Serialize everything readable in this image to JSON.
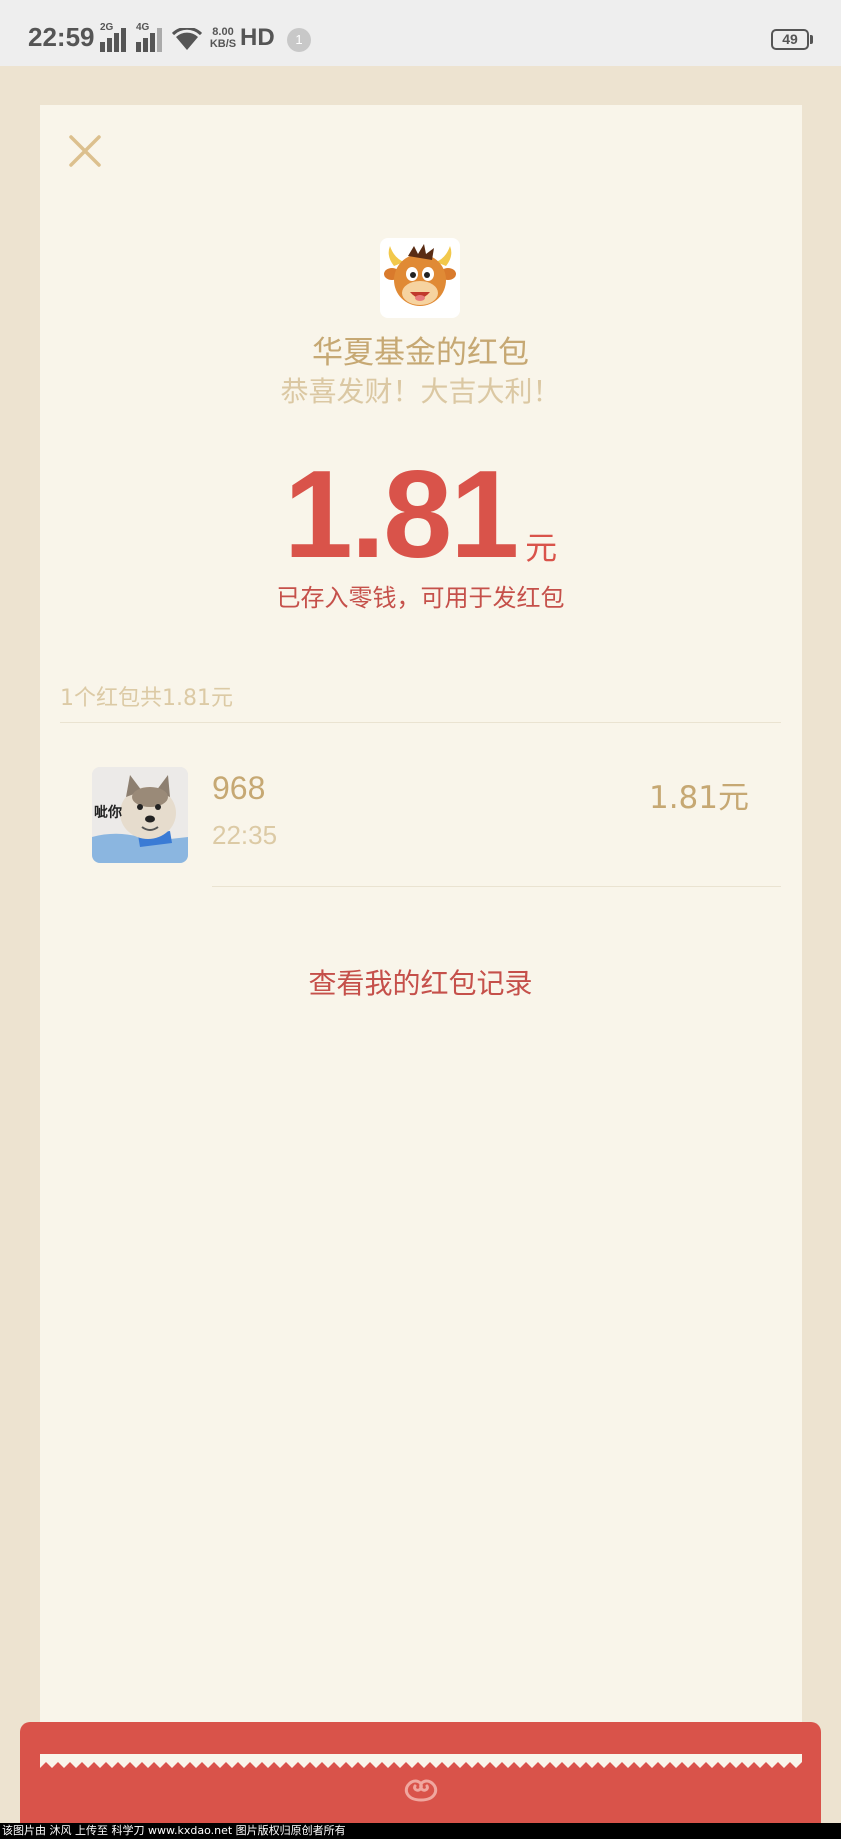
{
  "status_bar": {
    "time": "22:59",
    "signal_1_label": "2G",
    "signal_2_label": "4G",
    "net_speed_value": "8.00",
    "net_speed_unit": "KB/S",
    "hd_label": "HD",
    "notification_count": "1",
    "battery": "49"
  },
  "packet": {
    "sender_name": "华夏基金的红包",
    "blessing": "恭喜发财！大吉大利！",
    "amount": "1.81",
    "amount_unit": "元",
    "saved_note": "已存入零钱，可用于发红包",
    "summary": "1个红包共1.81元"
  },
  "receivers": [
    {
      "name": "968",
      "time": "22:35",
      "amount": "1.81元",
      "avatar_caption": "呲你"
    }
  ],
  "records_link": "查看我的红包记录",
  "watermark": "该图片由 沐风 上传至 科学刀 www.kxdao.net 图片版权归原创者所有",
  "colors": {
    "background": "#ede3d0",
    "card": "#f9f5ea",
    "accent_red": "#d9534a",
    "gold_text": "#c6a873",
    "light_gold_text": "#dccaa5"
  }
}
